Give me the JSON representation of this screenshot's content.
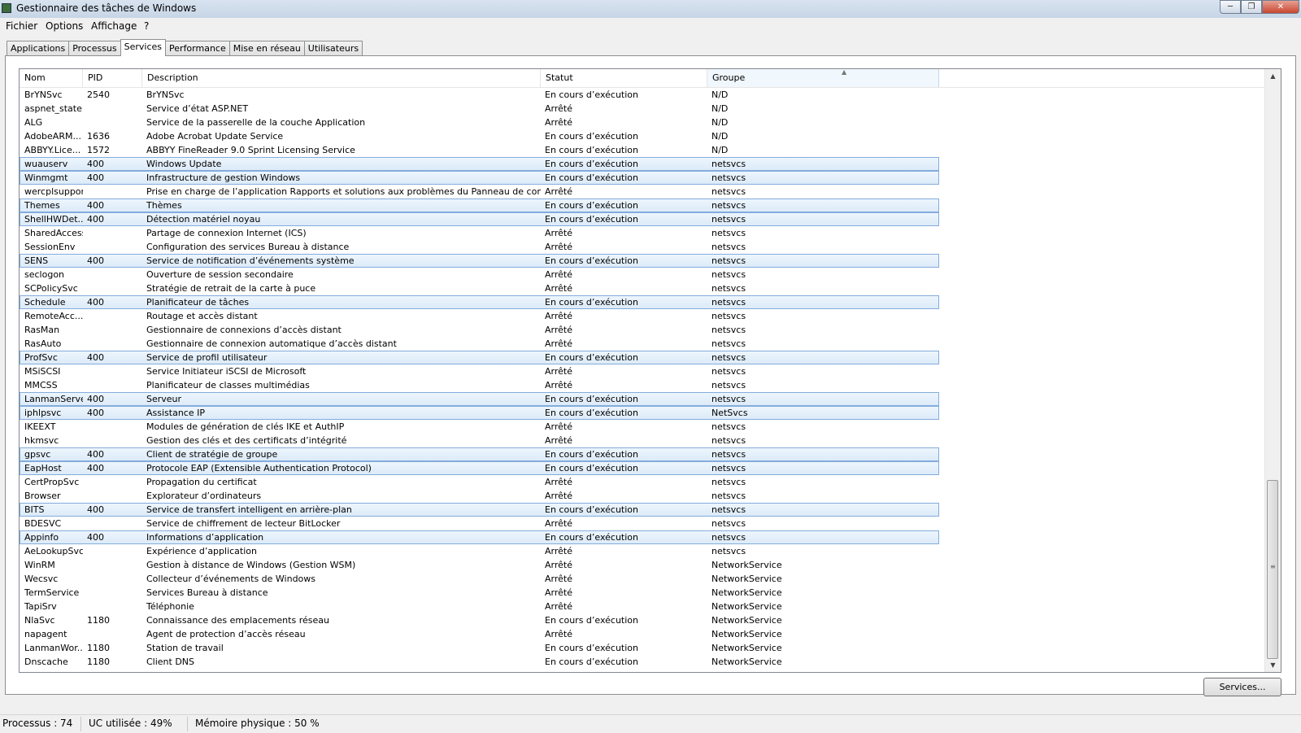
{
  "window": {
    "title": "Gestionnaire des tâches de Windows"
  },
  "menu": [
    "Fichier",
    "Options",
    "Affichage",
    "?"
  ],
  "tabs": [
    {
      "label": "Applications",
      "active": false
    },
    {
      "label": "Processus",
      "active": false
    },
    {
      "label": "Services",
      "active": true
    },
    {
      "label": "Performance",
      "active": false
    },
    {
      "label": "Mise en réseau",
      "active": false
    },
    {
      "label": "Utilisateurs",
      "active": false
    }
  ],
  "columns": [
    "Nom",
    "PID",
    "Description",
    "Statut",
    "Groupe"
  ],
  "sorted_column": "Groupe",
  "rows": [
    {
      "name": "BrYNSvc",
      "pid": "2540",
      "desc": "BrYNSvc",
      "status": "En cours d’exécution",
      "group": "N/D",
      "running": false
    },
    {
      "name": "aspnet_state",
      "pid": "",
      "desc": "Service d’état ASP.NET",
      "status": "Arrêté",
      "group": "N/D",
      "running": false
    },
    {
      "name": "ALG",
      "pid": "",
      "desc": "Service de la passerelle de la couche Application",
      "status": "Arrêté",
      "group": "N/D",
      "running": false
    },
    {
      "name": "AdobeARM...",
      "pid": "1636",
      "desc": "Adobe Acrobat Update Service",
      "status": "En cours d’exécution",
      "group": "N/D",
      "running": false
    },
    {
      "name": "ABBYY.Lice...",
      "pid": "1572",
      "desc": "ABBYY FineReader 9.0 Sprint Licensing Service",
      "status": "En cours d’exécution",
      "group": "N/D",
      "running": false
    },
    {
      "name": "wuauserv",
      "pid": "400",
      "desc": "Windows Update",
      "status": "En cours d’exécution",
      "group": "netsvcs",
      "running": true
    },
    {
      "name": "Winmgmt",
      "pid": "400",
      "desc": "Infrastructure de gestion Windows",
      "status": "En cours d’exécution",
      "group": "netsvcs",
      "running": true
    },
    {
      "name": "wercplsupport",
      "pid": "",
      "desc": "Prise en charge de l’application Rapports et solutions aux problèmes du Panneau de configuration",
      "status": "Arrêté",
      "group": "netsvcs",
      "running": false
    },
    {
      "name": "Themes",
      "pid": "400",
      "desc": "Thèmes",
      "status": "En cours d’exécution",
      "group": "netsvcs",
      "running": true
    },
    {
      "name": "ShellHWDet...",
      "pid": "400",
      "desc": "Détection matériel noyau",
      "status": "En cours d’exécution",
      "group": "netsvcs",
      "running": true
    },
    {
      "name": "SharedAccess",
      "pid": "",
      "desc": "Partage de connexion Internet (ICS)",
      "status": "Arrêté",
      "group": "netsvcs",
      "running": false
    },
    {
      "name": "SessionEnv",
      "pid": "",
      "desc": "Configuration des services Bureau à distance",
      "status": "Arrêté",
      "group": "netsvcs",
      "running": false
    },
    {
      "name": "SENS",
      "pid": "400",
      "desc": "Service de notification d’événements système",
      "status": "En cours d’exécution",
      "group": "netsvcs",
      "running": true
    },
    {
      "name": "seclogon",
      "pid": "",
      "desc": "Ouverture de session secondaire",
      "status": "Arrêté",
      "group": "netsvcs",
      "running": false
    },
    {
      "name": "SCPolicySvc",
      "pid": "",
      "desc": "Stratégie de retrait de la carte à puce",
      "status": "Arrêté",
      "group": "netsvcs",
      "running": false
    },
    {
      "name": "Schedule",
      "pid": "400",
      "desc": "Planificateur de tâches",
      "status": "En cours d’exécution",
      "group": "netsvcs",
      "running": true
    },
    {
      "name": "RemoteAcc...",
      "pid": "",
      "desc": "Routage et accès distant",
      "status": "Arrêté",
      "group": "netsvcs",
      "running": false
    },
    {
      "name": "RasMan",
      "pid": "",
      "desc": "Gestionnaire de connexions d’accès distant",
      "status": "Arrêté",
      "group": "netsvcs",
      "running": false
    },
    {
      "name": "RasAuto",
      "pid": "",
      "desc": "Gestionnaire de connexion automatique d’accès distant",
      "status": "Arrêté",
      "group": "netsvcs",
      "running": false
    },
    {
      "name": "ProfSvc",
      "pid": "400",
      "desc": "Service de profil utilisateur",
      "status": "En cours d’exécution",
      "group": "netsvcs",
      "running": true
    },
    {
      "name": "MSiSCSI",
      "pid": "",
      "desc": "Service Initiateur iSCSI de Microsoft",
      "status": "Arrêté",
      "group": "netsvcs",
      "running": false
    },
    {
      "name": "MMCSS",
      "pid": "",
      "desc": "Planificateur de classes multimédias",
      "status": "Arrêté",
      "group": "netsvcs",
      "running": false
    },
    {
      "name": "LanmanServer",
      "pid": "400",
      "desc": "Serveur",
      "status": "En cours d’exécution",
      "group": "netsvcs",
      "running": true
    },
    {
      "name": "iphlpsvc",
      "pid": "400",
      "desc": "Assistance IP",
      "status": "En cours d’exécution",
      "group": "NetSvcs",
      "running": true
    },
    {
      "name": "IKEEXT",
      "pid": "",
      "desc": "Modules de génération de clés IKE et AuthIP",
      "status": "Arrêté",
      "group": "netsvcs",
      "running": false
    },
    {
      "name": "hkmsvc",
      "pid": "",
      "desc": "Gestion des clés et des certificats d’intégrité",
      "status": "Arrêté",
      "group": "netsvcs",
      "running": false
    },
    {
      "name": "gpsvc",
      "pid": "400",
      "desc": "Client de stratégie de groupe",
      "status": "En cours d’exécution",
      "group": "netsvcs",
      "running": true
    },
    {
      "name": "EapHost",
      "pid": "400",
      "desc": "Protocole EAP (Extensible Authentication Protocol)",
      "status": "En cours d’exécution",
      "group": "netsvcs",
      "running": true
    },
    {
      "name": "CertPropSvc",
      "pid": "",
      "desc": "Propagation du certificat",
      "status": "Arrêté",
      "group": "netsvcs",
      "running": false
    },
    {
      "name": "Browser",
      "pid": "",
      "desc": "Explorateur d’ordinateurs",
      "status": "Arrêté",
      "group": "netsvcs",
      "running": false
    },
    {
      "name": "BITS",
      "pid": "400",
      "desc": "Service de transfert intelligent en arrière-plan",
      "status": "En cours d’exécution",
      "group": "netsvcs",
      "running": true
    },
    {
      "name": "BDESVC",
      "pid": "",
      "desc": "Service de chiffrement de lecteur BitLocker",
      "status": "Arrêté",
      "group": "netsvcs",
      "running": false
    },
    {
      "name": "Appinfo",
      "pid": "400",
      "desc": "Informations d’application",
      "status": "En cours d’exécution",
      "group": "netsvcs",
      "running": true
    },
    {
      "name": "AeLookupSvc",
      "pid": "",
      "desc": "Expérience d’application",
      "status": "Arrêté",
      "group": "netsvcs",
      "running": false
    },
    {
      "name": "WinRM",
      "pid": "",
      "desc": "Gestion à distance de Windows (Gestion WSM)",
      "status": "Arrêté",
      "group": "NetworkService",
      "running": false
    },
    {
      "name": "Wecsvc",
      "pid": "",
      "desc": "Collecteur d’événements de Windows",
      "status": "Arrêté",
      "group": "NetworkService",
      "running": false
    },
    {
      "name": "TermService",
      "pid": "",
      "desc": "Services Bureau à distance",
      "status": "Arrêté",
      "group": "NetworkService",
      "running": false
    },
    {
      "name": "TapiSrv",
      "pid": "",
      "desc": "Téléphonie",
      "status": "Arrêté",
      "group": "NetworkService",
      "running": false
    },
    {
      "name": "NlaSvc",
      "pid": "1180",
      "desc": "Connaissance des emplacements réseau",
      "status": "En cours d’exécution",
      "group": "NetworkService",
      "running": false
    },
    {
      "name": "napagent",
      "pid": "",
      "desc": "Agent de protection d’accès réseau",
      "status": "Arrêté",
      "group": "NetworkService",
      "running": false
    },
    {
      "name": "LanmanWor...",
      "pid": "1180",
      "desc": "Station de travail",
      "status": "En cours d’exécution",
      "group": "NetworkService",
      "running": false
    },
    {
      "name": "Dnscache",
      "pid": "1180",
      "desc": "Client DNS",
      "status": "En cours d’exécution",
      "group": "NetworkService",
      "running": false
    }
  ],
  "services_button": "Services...",
  "status_bar": {
    "processes": "Processus : 74",
    "cpu": "UC utilisée : 49%",
    "memory": "Mémoire physique : 50 %"
  },
  "colors": {
    "highlight_bg": "#dbeaf8",
    "highlight_border": "#84acdd",
    "sorted_header_bg": "#f0f7fd"
  }
}
